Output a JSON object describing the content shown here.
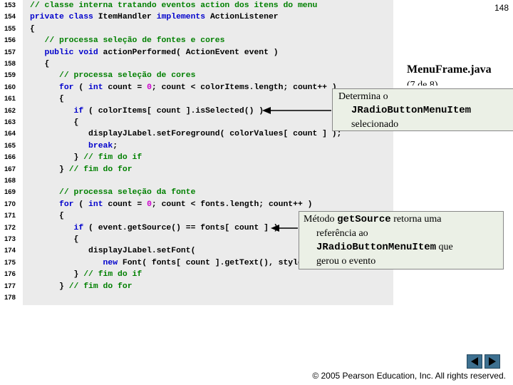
{
  "page_number": "148",
  "file_title": "MenuFrame.java",
  "file_subtitle": "(7 de 8)",
  "code_lines": [
    {
      "num": "153",
      "tokens": [
        {
          "t": "comment",
          "v": "// classe interna tratando eventos action dos itens do menu"
        }
      ]
    },
    {
      "num": "154",
      "tokens": [
        {
          "t": "keyword",
          "v": "private class "
        },
        {
          "t": "plain",
          "v": "ItemHandler "
        },
        {
          "t": "keyword",
          "v": "implements "
        },
        {
          "t": "plain",
          "v": "ActionListener"
        }
      ]
    },
    {
      "num": "155",
      "tokens": [
        {
          "t": "plain",
          "v": "{"
        }
      ]
    },
    {
      "num": "156",
      "tokens": [
        {
          "t": "comment",
          "v": "   // processa seleção de fontes e cores"
        }
      ]
    },
    {
      "num": "157",
      "tokens": [
        {
          "t": "keyword",
          "v": "   public void "
        },
        {
          "t": "plain",
          "v": "actionPerformed( ActionEvent event )"
        }
      ]
    },
    {
      "num": "158",
      "tokens": [
        {
          "t": "plain",
          "v": "   {"
        }
      ]
    },
    {
      "num": "159",
      "tokens": [
        {
          "t": "comment",
          "v": "      // processa seleção de cores"
        }
      ]
    },
    {
      "num": "160",
      "tokens": [
        {
          "t": "keyword",
          "v": "      for "
        },
        {
          "t": "plain",
          "v": "( "
        },
        {
          "t": "keyword",
          "v": "int "
        },
        {
          "t": "plain",
          "v": "count = "
        },
        {
          "t": "number",
          "v": "0"
        },
        {
          "t": "plain",
          "v": "; count < colorItems.length; count++ )"
        }
      ]
    },
    {
      "num": "161",
      "tokens": [
        {
          "t": "plain",
          "v": "      {"
        }
      ]
    },
    {
      "num": "162",
      "tokens": [
        {
          "t": "keyword",
          "v": "         if "
        },
        {
          "t": "plain",
          "v": "( colorItems[ count ].isSelected() )"
        }
      ]
    },
    {
      "num": "163",
      "tokens": [
        {
          "t": "plain",
          "v": "         {"
        }
      ]
    },
    {
      "num": "164",
      "tokens": [
        {
          "t": "plain",
          "v": "            displayJLabel.setForeground( colorValues[ count ] );"
        }
      ]
    },
    {
      "num": "165",
      "tokens": [
        {
          "t": "keyword",
          "v": "            break"
        },
        {
          "t": "plain",
          "v": ";"
        }
      ]
    },
    {
      "num": "166",
      "tokens": [
        {
          "t": "plain",
          "v": "         } "
        },
        {
          "t": "comment",
          "v": "// fim do if"
        }
      ]
    },
    {
      "num": "167",
      "tokens": [
        {
          "t": "plain",
          "v": "      } "
        },
        {
          "t": "comment",
          "v": "// fim do for"
        }
      ]
    },
    {
      "num": "168",
      "tokens": []
    },
    {
      "num": "169",
      "tokens": [
        {
          "t": "comment",
          "v": "      // processa seleção da fonte"
        }
      ]
    },
    {
      "num": "170",
      "tokens": [
        {
          "t": "keyword",
          "v": "      for "
        },
        {
          "t": "plain",
          "v": "( "
        },
        {
          "t": "keyword",
          "v": "int "
        },
        {
          "t": "plain",
          "v": "count = "
        },
        {
          "t": "number",
          "v": "0"
        },
        {
          "t": "plain",
          "v": "; count < fonts.length; count++ )"
        }
      ]
    },
    {
      "num": "171",
      "tokens": [
        {
          "t": "plain",
          "v": "      {"
        }
      ]
    },
    {
      "num": "172",
      "tokens": [
        {
          "t": "keyword",
          "v": "         if "
        },
        {
          "t": "plain",
          "v": "( event.getSource() == fonts[ count ] )"
        }
      ]
    },
    {
      "num": "173",
      "tokens": [
        {
          "t": "plain",
          "v": "         {"
        }
      ]
    },
    {
      "num": "174",
      "tokens": [
        {
          "t": "plain",
          "v": "            displayJLabel.setFont("
        }
      ]
    },
    {
      "num": "175",
      "tokens": [
        {
          "t": "keyword",
          "v": "               new "
        },
        {
          "t": "plain",
          "v": "Font( fonts[ count ].getText(), style,"
        }
      ]
    },
    {
      "num": "176",
      "tokens": [
        {
          "t": "plain",
          "v": "         } "
        },
        {
          "t": "comment",
          "v": "// fim do if"
        }
      ]
    },
    {
      "num": "177",
      "tokens": [
        {
          "t": "plain",
          "v": "      } "
        },
        {
          "t": "comment",
          "v": "// fim do for"
        }
      ]
    },
    {
      "num": "178",
      "tokens": []
    }
  ],
  "callout_1": {
    "line1": "Determina o",
    "code": "JRadioButtonMenuItem",
    "line3": "selecionado"
  },
  "callout_2": {
    "prefix": "Método ",
    "code1": "getSource",
    "after1": " retorna uma",
    "line2": "referência ao",
    "code2": "JRadioButtonMenuItem",
    "after2": " que",
    "line4": "gerou o evento"
  },
  "nav": {
    "prev_icon": "triangle-left-icon",
    "next_icon": "triangle-right-icon"
  },
  "footer": "© 2005 Pearson Education, Inc.  All rights reserved.",
  "colors": {
    "comment": "#008000",
    "keyword": "#0000cc",
    "number": "#cc00cc",
    "code_bg": "#ebebeb",
    "callout_bg": "#ebf0e6",
    "nav_button": "#3d7090"
  }
}
